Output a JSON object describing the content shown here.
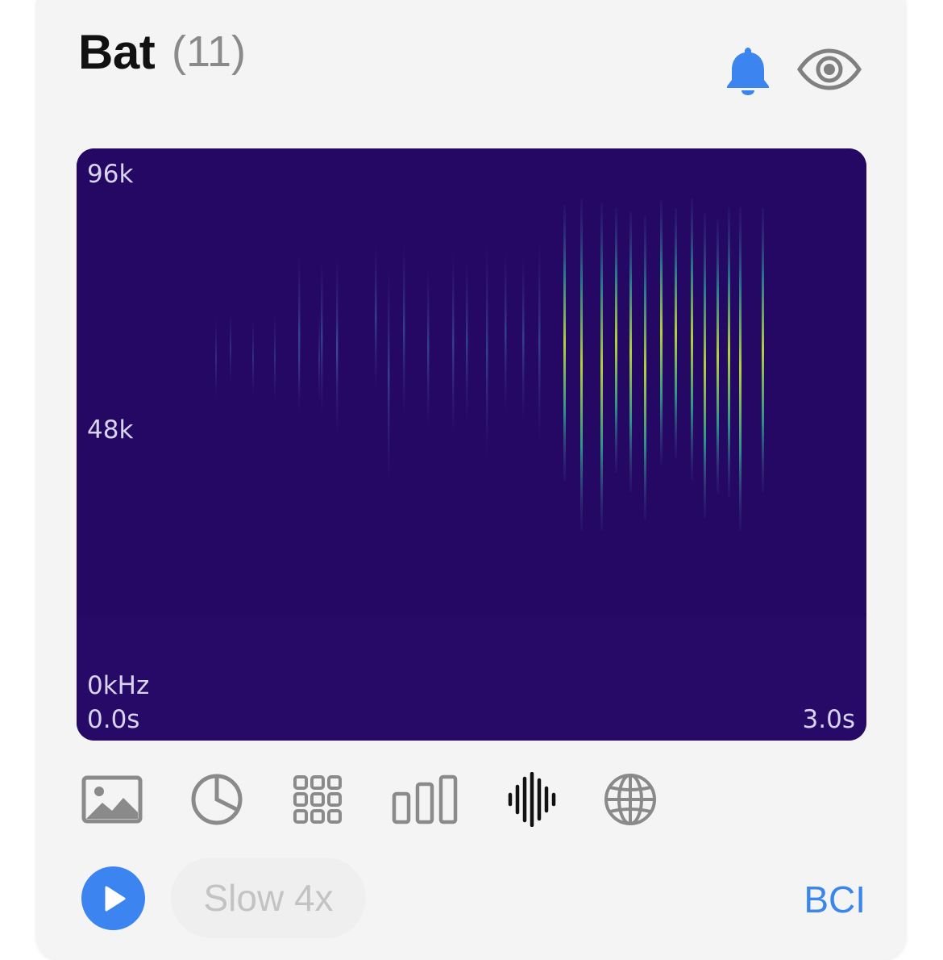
{
  "header": {
    "title": "Bat",
    "count": "(11)"
  },
  "icons": {
    "alert": "bell-icon",
    "visibility": "eye-icon"
  },
  "colors": {
    "accent": "#3c84f0",
    "spectrogram_bg": "#240863",
    "icon_gray": "#8a8a8a"
  },
  "spectrogram": {
    "y_top": "96k",
    "y_mid": "48k",
    "y_bottom": "0kHz",
    "x_start": "0.0s",
    "x_end": "3.0s"
  },
  "toolbar": {
    "items": [
      {
        "name": "image-icon",
        "selected": false
      },
      {
        "name": "pie-chart-icon",
        "selected": false
      },
      {
        "name": "grid-icon",
        "selected": false
      },
      {
        "name": "bar-chart-icon",
        "selected": false
      },
      {
        "name": "waveform-icon",
        "selected": true
      },
      {
        "name": "globe-icon",
        "selected": false
      }
    ]
  },
  "player": {
    "speed_label": "Slow 4x",
    "source_label": "BCI"
  }
}
